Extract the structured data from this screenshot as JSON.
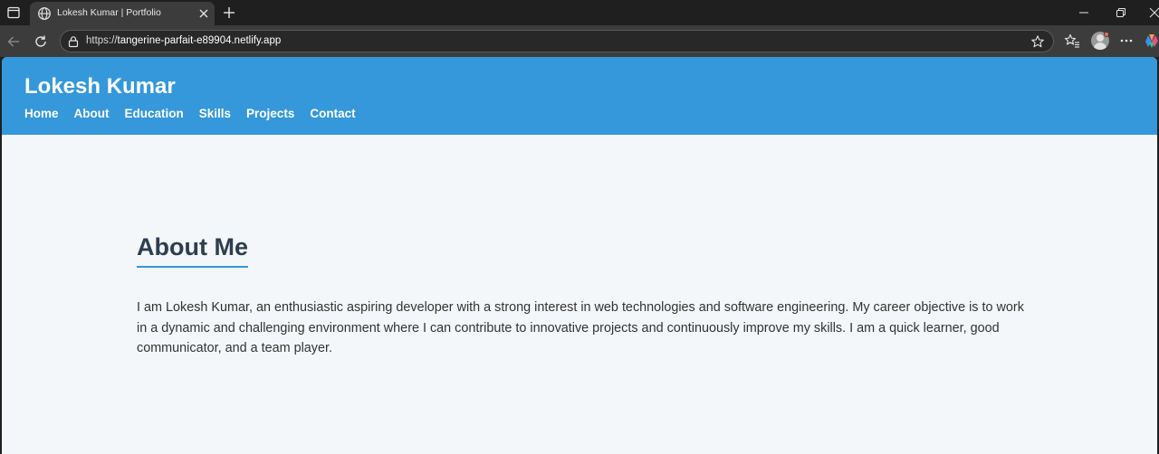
{
  "browser": {
    "tab": {
      "title": "Lokesh Kumar | Portfolio"
    },
    "address": {
      "scheme": "https://",
      "host": "tangerine-parfait-e89904.netlify.app"
    }
  },
  "site": {
    "title": "Lokesh Kumar",
    "nav": [
      "Home",
      "About",
      "Education",
      "Skills",
      "Projects",
      "Contact"
    ]
  },
  "about": {
    "heading": "About Me",
    "text": "I am Lokesh Kumar, an enthusiastic aspiring developer with a strong interest in web technologies and software engineering. My career objective is to work in a dynamic and challenging environment where I can contribute to innovative projects and continuously improve my skills. I am a quick learner, good communicator, and a team player."
  },
  "colors": {
    "header": "#3498db",
    "heading": "#2c3e50",
    "page_background": "#f4f7f9"
  }
}
